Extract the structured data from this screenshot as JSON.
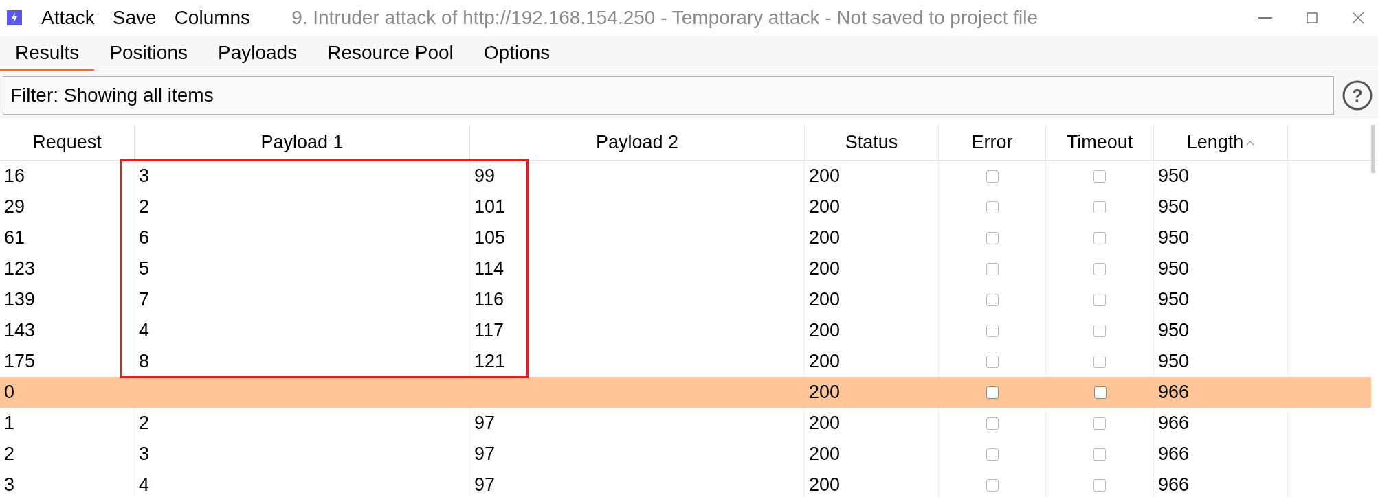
{
  "window": {
    "title": "9. Intruder attack of http://192.168.154.250 - Temporary attack - Not saved to project file",
    "menu": [
      "Attack",
      "Save",
      "Columns"
    ]
  },
  "tabs": [
    {
      "label": "Results",
      "selected": true
    },
    {
      "label": "Positions",
      "selected": false
    },
    {
      "label": "Payloads",
      "selected": false
    },
    {
      "label": "Resource Pool",
      "selected": false
    },
    {
      "label": "Options",
      "selected": false
    }
  ],
  "filter": {
    "text": "Filter: Showing all items",
    "help_label": "?"
  },
  "table": {
    "columns": [
      {
        "label": "Request"
      },
      {
        "label": "Payload 1"
      },
      {
        "label": "Payload 2"
      },
      {
        "label": "Status"
      },
      {
        "label": "Error"
      },
      {
        "label": "Timeout"
      },
      {
        "label": "Length",
        "sorted": true
      }
    ],
    "rows": [
      {
        "request": "16",
        "payload_1": "3",
        "payload_2": "99",
        "status": "200",
        "error": false,
        "timeout": false,
        "length": "950",
        "selected": false,
        "outlined": true
      },
      {
        "request": "29",
        "payload_1": "2",
        "payload_2": "101",
        "status": "200",
        "error": false,
        "timeout": false,
        "length": "950",
        "selected": false,
        "outlined": true
      },
      {
        "request": "61",
        "payload_1": "6",
        "payload_2": "105",
        "status": "200",
        "error": false,
        "timeout": false,
        "length": "950",
        "selected": false,
        "outlined": true
      },
      {
        "request": "123",
        "payload_1": "5",
        "payload_2": "114",
        "status": "200",
        "error": false,
        "timeout": false,
        "length": "950",
        "selected": false,
        "outlined": true
      },
      {
        "request": "139",
        "payload_1": "7",
        "payload_2": "116",
        "status": "200",
        "error": false,
        "timeout": false,
        "length": "950",
        "selected": false,
        "outlined": true
      },
      {
        "request": "143",
        "payload_1": "4",
        "payload_2": "117",
        "status": "200",
        "error": false,
        "timeout": false,
        "length": "950",
        "selected": false,
        "outlined": true
      },
      {
        "request": "175",
        "payload_1": "8",
        "payload_2": "121",
        "status": "200",
        "error": false,
        "timeout": false,
        "length": "950",
        "selected": false,
        "outlined": true
      },
      {
        "request": "0",
        "status": "200",
        "error": false,
        "timeout": false,
        "length": "966",
        "selected": true,
        "outlined": false
      },
      {
        "request": "1",
        "payload_1": "2",
        "payload_2": "97",
        "status": "200",
        "error": false,
        "timeout": false,
        "length": "966",
        "selected": false,
        "outlined": false
      },
      {
        "request": "2",
        "payload_1": "3",
        "payload_2": "97",
        "status": "200",
        "error": false,
        "timeout": false,
        "length": "966",
        "selected": false,
        "outlined": false
      },
      {
        "request": "3",
        "payload_1": "4",
        "payload_2": "97",
        "status": "200",
        "error": false,
        "timeout": false,
        "length": "966",
        "selected": false,
        "outlined": false
      }
    ]
  }
}
